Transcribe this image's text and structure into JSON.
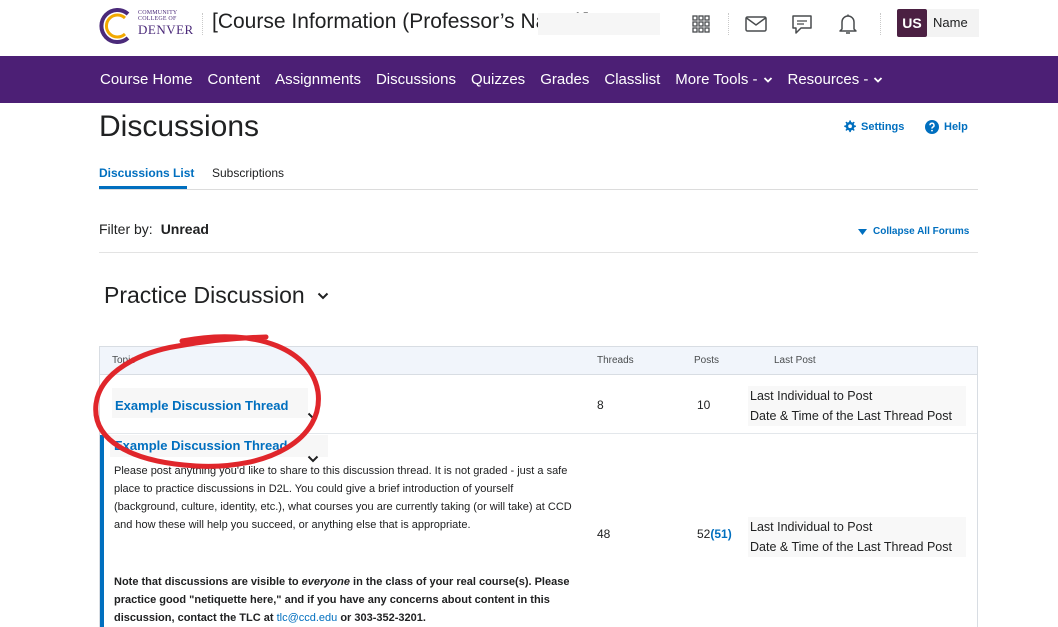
{
  "header": {
    "logo_small": "COMMUNITY COLLEGE OF",
    "logo_big": "DENVER",
    "course_title": "[Course Information (Professor’s Name)]",
    "icons": [
      "grid-icon",
      "mail-icon",
      "chat-icon",
      "bell-icon"
    ],
    "user_initials": "US",
    "user_name": "Name"
  },
  "nav": {
    "items": [
      {
        "label": "Course Home"
      },
      {
        "label": "Content"
      },
      {
        "label": "Assignments"
      },
      {
        "label": "Discussions"
      },
      {
        "label": "Quizzes"
      },
      {
        "label": "Grades"
      },
      {
        "label": "Classlist"
      },
      {
        "label": "More Tools -"
      },
      {
        "label": "Resources -"
      }
    ],
    "color": "#4c1f75"
  },
  "page": {
    "title": "Discussions",
    "settings_label": "Settings",
    "help_label": "Help",
    "tabs": [
      {
        "label": "Discussions List"
      },
      {
        "label": "Subscriptions"
      }
    ],
    "filter_label": "Filter by:",
    "filter_value": "Unread",
    "collapse_label": "Collapse All Forums"
  },
  "forum": {
    "title": "Practice Discussion",
    "columns": {
      "topic": "Topic",
      "threads": "Threads",
      "posts": "Posts",
      "last_post": "Last Post"
    },
    "rows": [
      {
        "topic": "Example Discussion Thread",
        "threads": "8",
        "posts": "10",
        "last_author": "Last Individual to Post",
        "last_date": "Date & Time of the Last Thread Post"
      },
      {
        "topic": "Example Discussion Thread",
        "description": "Please post anything you'd like to share to this discussion thread. It is not graded - just a safe place to practice discussions in D2L. You could give a brief introduction of yourself (background, culture, identity, etc.), what courses you are currently taking (or will take) at CCD and how these will help you succeed, or anything else that is appropriate.",
        "note_part1": "Note that discussions are visible to ",
        "note_emph": "everyone",
        "note_part2": " in the class of your real course(s). Please practice good \"netiquette here,\" and if you have any concerns about content in this discussion, contact the TLC at ",
        "note_email": "tlc@ccd.edu",
        "note_part3": " or 303-352-3201.",
        "threads": "48",
        "posts": "52",
        "posts_unread": "(51)",
        "last_author": "Last Individual to Post",
        "last_date": "Date & Time of the Last Thread Post"
      }
    ]
  },
  "colors": {
    "accent": "#006fbf",
    "annotation": "#e0262b"
  }
}
